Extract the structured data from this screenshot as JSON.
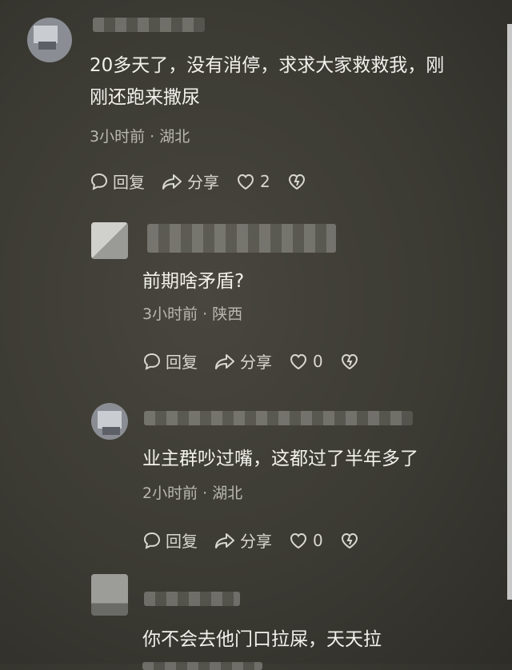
{
  "comments": [
    {
      "text": "20多天了，没有消停，求求大家救救我，刚\n刚还跑来撒尿",
      "time": "3小时前",
      "location": "湖北",
      "reply": "回复",
      "share": "分享",
      "likes": "2"
    },
    {
      "text": "前期啥矛盾?",
      "time": "3小时前",
      "location": "陕西",
      "reply": "回复",
      "share": "分享",
      "likes": "0"
    },
    {
      "text": "业主群吵过嘴，这都过了半年多了",
      "time": "2小时前",
      "location": "湖北",
      "reply": "回复",
      "share": "分享",
      "likes": "0"
    },
    {
      "text": "你不会去他门口拉屎，天天拉"
    }
  ],
  "separator": "·",
  "icons": [
    "reply-icon",
    "share-icon",
    "like-icon",
    "dislike-icon"
  ]
}
